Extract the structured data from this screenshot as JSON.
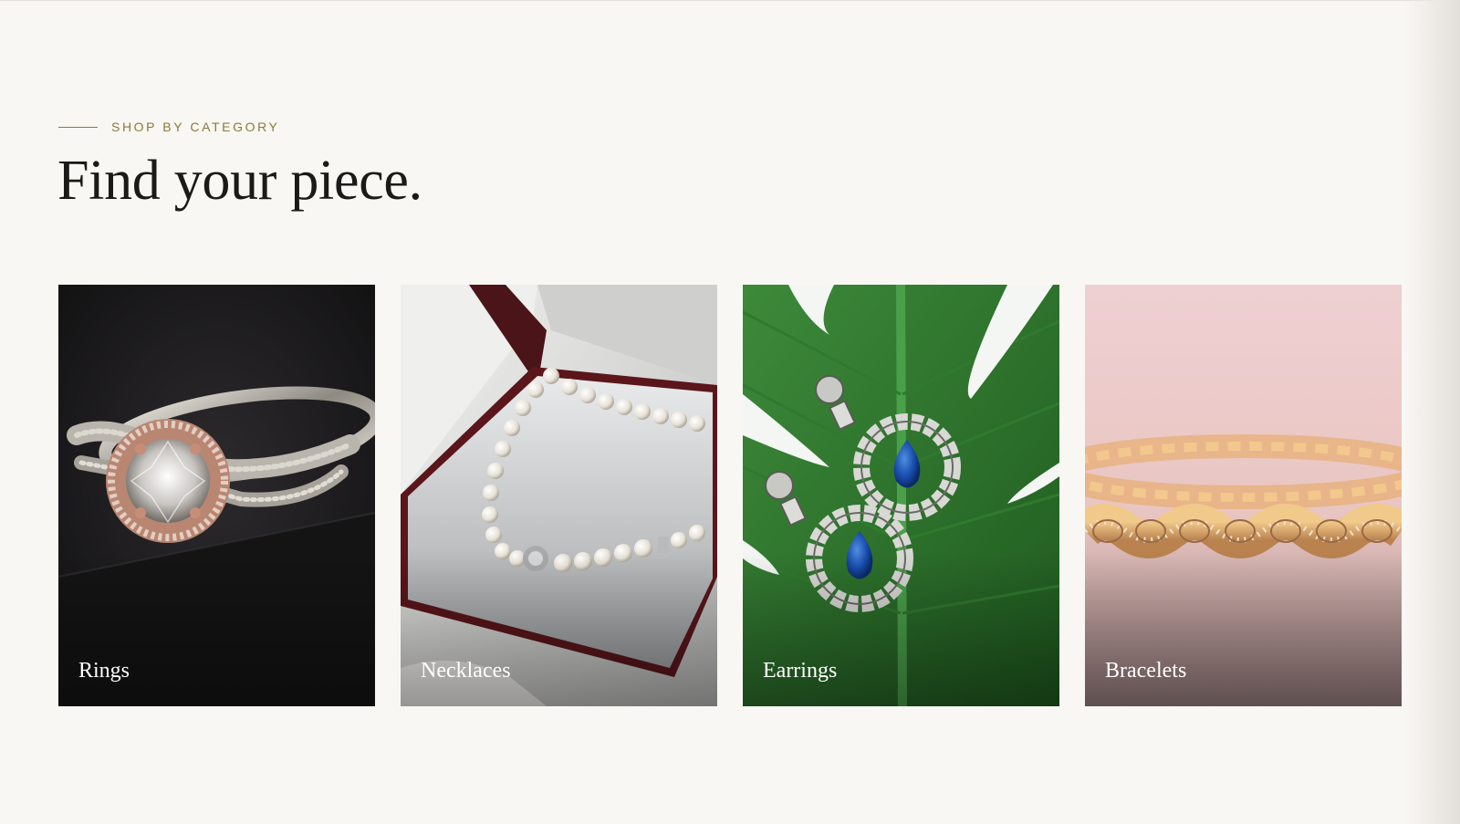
{
  "section": {
    "eyebrow": "SHOP BY CATEGORY",
    "title": "Find your piece."
  },
  "categories": [
    {
      "label": "Rings",
      "icon": "ring-photo"
    },
    {
      "label": "Necklaces",
      "icon": "pearl-necklace-photo"
    },
    {
      "label": "Earrings",
      "icon": "sapphire-earrings-photo"
    },
    {
      "label": "Bracelets",
      "icon": "gold-bracelet-photo"
    }
  ],
  "colors": {
    "background": "#f9f7f3",
    "accent": "#8a7a3a",
    "heading": "#1c1a17",
    "card_label": "#ffffff"
  }
}
